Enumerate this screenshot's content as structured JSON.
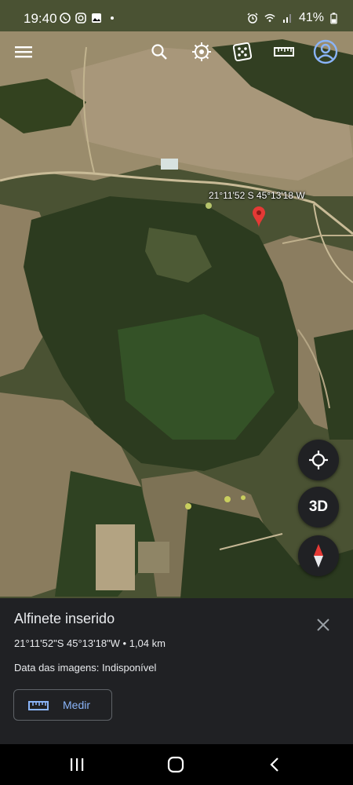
{
  "status_bar": {
    "time": "19:40",
    "battery": "41%",
    "left_icons": [
      "whatsapp-icon",
      "instagram-icon",
      "gallery-icon",
      "dot-icon"
    ],
    "right_icons": [
      "alarm-icon",
      "wifi-icon",
      "signal-icon",
      "battery-icon"
    ]
  },
  "toolbar": {
    "icons": [
      "menu-icon",
      "search-icon",
      "voyager-icon",
      "random-dice-icon",
      "ruler-icon",
      "account-icon"
    ]
  },
  "map": {
    "pin_label": "21°11'52 S 45°13'18 W",
    "pin_color": "#e53935",
    "buttons": {
      "location_icon": "my-location-icon",
      "mode_3d": "3D",
      "compass_icon": "compass-icon"
    }
  },
  "sheet": {
    "title": "Alfinete inserido",
    "coords": "21°11'52\"S 45°13'18\"W • 1,04 km",
    "image_date": "Data das imagens: Indisponível",
    "measure_label": "Medir",
    "close_icon": "close-icon"
  },
  "nav": {
    "icons": [
      "recent-apps-icon",
      "home-icon",
      "back-icon"
    ]
  },
  "colors": {
    "sheet_bg": "#202124",
    "accent_blue": "#8ab4f8",
    "fab_bg": "#202124"
  }
}
